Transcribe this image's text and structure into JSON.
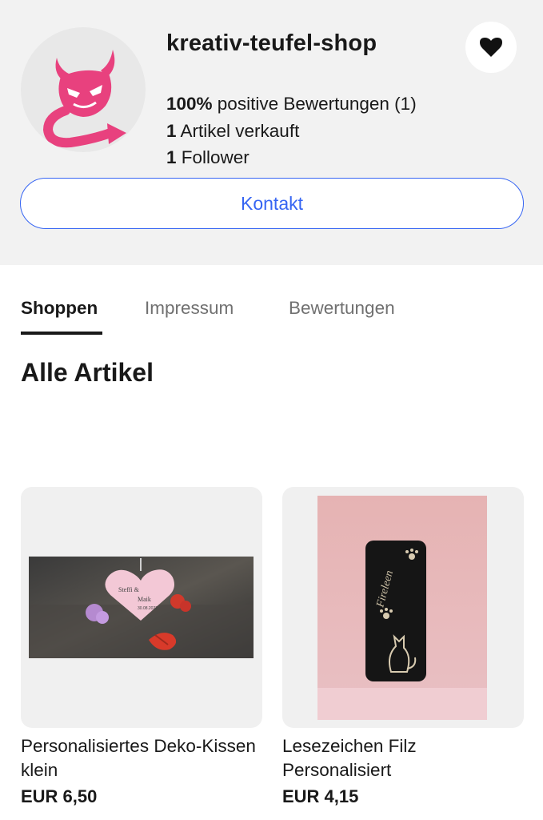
{
  "shop": {
    "name": "kreativ-teufel-shop",
    "rating_strong": "100%",
    "rating_rest": " positive Bewertungen (1)",
    "sold_count": "1",
    "sold_label": " Artikel verkauft",
    "followers_count": "1",
    "followers_label": " Follower",
    "contact_label": "Kontakt"
  },
  "tabs": [
    {
      "label": "Shoppen",
      "active": true
    },
    {
      "label": "Impressum",
      "active": false
    },
    {
      "label": "Bewertungen",
      "active": false
    }
  ],
  "section": {
    "title": "Alle Artikel"
  },
  "items": [
    {
      "title": "Personalisiertes Deko-Kissen klein",
      "price": "EUR 6,50",
      "image": "heart-pillow-photo"
    },
    {
      "title": "Lesezeichen Filz Personalisiert",
      "price": "EUR 4,15",
      "image": "felt-bookmark-photo"
    }
  ],
  "photo_text": {
    "pillow_line1": "Steffi &",
    "pillow_line2": "Maik",
    "pillow_line3": "30.08.2022",
    "bookmark_name": "Fireleen"
  },
  "colors": {
    "accent": "#3665f3",
    "logo_pink": "#e8417e",
    "header_bg": "#f2f2f2"
  },
  "icons": {
    "logo": "devil-logo-icon",
    "follow": "heart-icon"
  }
}
